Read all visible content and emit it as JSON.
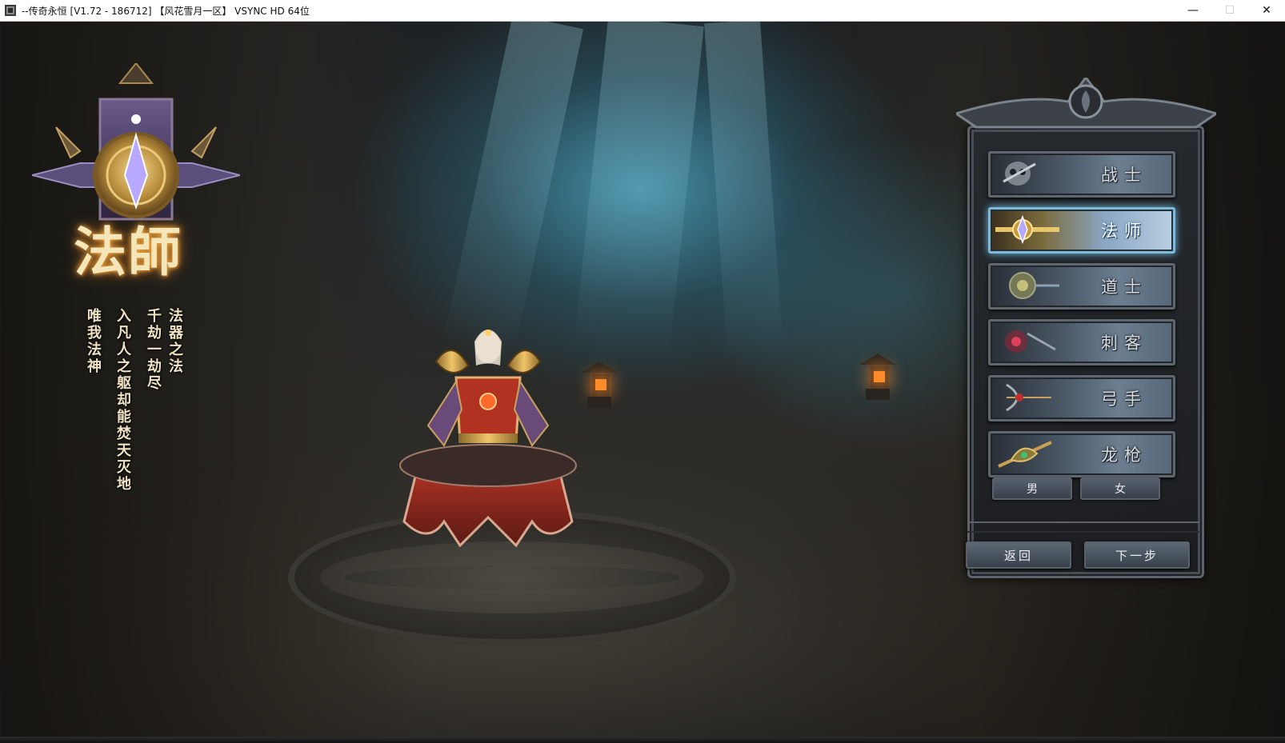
{
  "window": {
    "title": "--传奇永恒 [V1.72 - 186712] 【风花雪月一区】 VSYNC HD 64位",
    "minimize": "—",
    "maximize": "☐",
    "close": "✕"
  },
  "hero": {
    "class_title": "法師",
    "tagline_columns": [
      "法器之法",
      "千劫一劫尽",
      "入凡人之躯却能焚天灭地",
      "唯我法神"
    ]
  },
  "panel": {
    "classes": [
      {
        "label": "战士",
        "emblem": "skull-emblem-icon",
        "selected": false
      },
      {
        "label": "法师",
        "emblem": "crystal-staff-emblem-icon",
        "selected": true
      },
      {
        "label": "道士",
        "emblem": "taoist-disc-emblem-icon",
        "selected": false
      },
      {
        "label": "刺客",
        "emblem": "assassin-mask-emblem-icon",
        "selected": false
      },
      {
        "label": "弓手",
        "emblem": "archer-emblem-icon",
        "selected": false
      },
      {
        "label": "龙枪",
        "emblem": "dragon-lance-emblem-icon",
        "selected": false
      }
    ],
    "gender": {
      "male": "男",
      "female": "女"
    },
    "back": "返回",
    "next": "下一步"
  },
  "colors": {
    "selected_glow": "#7fb9d8",
    "title_glow": "#ffb84a",
    "button_steel": "#5e666f"
  }
}
